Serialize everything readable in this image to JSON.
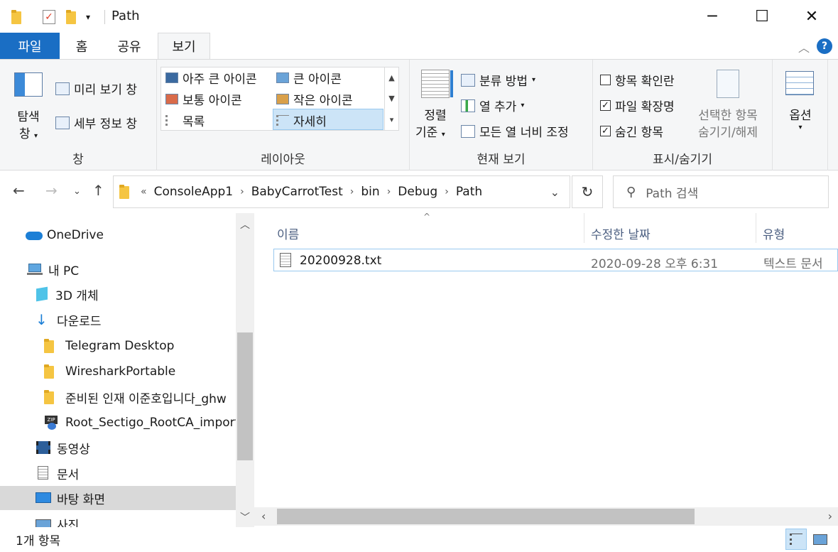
{
  "window": {
    "title": "Path",
    "minimize": "─",
    "maximize": "☐",
    "close": "✕"
  },
  "ribbon_tabs": {
    "file": "파일",
    "home": "홈",
    "share": "공유",
    "view": "보기"
  },
  "ribbon": {
    "panes": {
      "nav_pane_line1": "탐색",
      "nav_pane_line2": "창",
      "preview_pane": "미리 보기 창",
      "details_pane": "세부 정보 창",
      "label": "창"
    },
    "layout": {
      "extra_large": "아주 큰 아이콘",
      "large": "큰 아이콘",
      "medium": "보통 아이콘",
      "small": "작은 아이콘",
      "list": "목록",
      "details": "자세히",
      "label": "레이아웃"
    },
    "current_view": {
      "sort_line1": "정렬",
      "sort_line2": "기준",
      "group_by": "분류 방법",
      "add_columns": "열 추가",
      "size_all_columns": "모든 열 너비 조정",
      "label": "현재 보기"
    },
    "show_hide": {
      "item_checkboxes": "항목 확인란",
      "file_extensions": "파일 확장명",
      "hidden_items": "숨긴 항목",
      "hide_selected_line1": "선택한 항목",
      "hide_selected_line2": "숨기기/해제",
      "label": "표시/숨기기",
      "item_checkboxes_checked": false,
      "file_extensions_checked": true,
      "hidden_items_checked": true
    },
    "options": "옵션"
  },
  "address": {
    "overflow": "«",
    "crumbs": [
      "ConsoleApp1",
      "BabyCarrotTest",
      "bin",
      "Debug",
      "Path"
    ],
    "search_placeholder": "Path 검색"
  },
  "nav_tree": {
    "items": [
      "OneDrive",
      "내 PC",
      "3D 개체",
      "다운로드",
      "Telegram Desktop",
      "WiresharkPortable",
      "준비된 인재 이준호입니다_ghw",
      "Root_Sectigo_RootCA_import.zip",
      "동영상",
      "문서",
      "바탕 화면",
      "사진"
    ]
  },
  "file_list": {
    "columns": {
      "name": "이름",
      "modified": "수정한 날짜",
      "type": "유형"
    },
    "rows": [
      {
        "name": "20200928.txt",
        "modified": "2020-09-28 오후 6:31",
        "type": "텍스트 문서"
      }
    ]
  },
  "status": {
    "count": "1개 항목"
  }
}
